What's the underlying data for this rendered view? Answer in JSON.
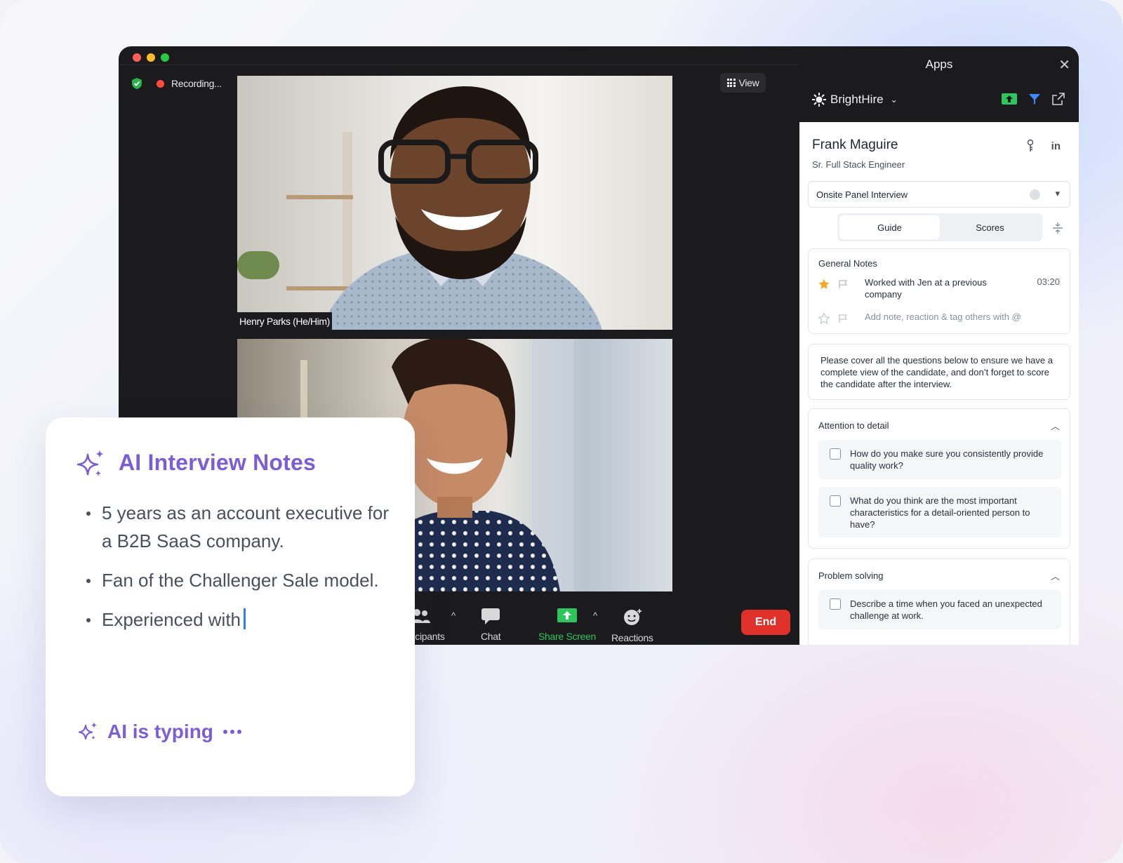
{
  "window": {
    "recording_label": "Recording...",
    "view_label": "View",
    "participant1_name": "Henry Parks (He/Him)",
    "toolbar": {
      "participants_label": "Participants",
      "chat_label": "Chat",
      "share_label": "Share Screen",
      "reactions_label": "Reactions",
      "end_label": "End"
    }
  },
  "apps": {
    "title": "Apps",
    "app_name": "BrightHire",
    "candidate": {
      "name": "Frank Maguire",
      "role": "Sr. Full Stack Engineer",
      "linkedin_label": "in"
    },
    "interview_select": "Onsite Panel Interview",
    "tabs": [
      "Guide",
      "Scores"
    ],
    "general_notes": {
      "title": "General Notes",
      "note_text": "Worked with Jen at a previous company",
      "note_time": "03:20",
      "add_placeholder": "Add note, reaction & tag others with @"
    },
    "guide_text": "Please cover all the questions below to ensure we have a complete view of the candidate, and don’t forget to score the candidate after the interview.",
    "sections": [
      {
        "title": "Attention to detail",
        "questions": [
          "How do you make sure you consistently provide quality work?",
          "What do you think are the most important characteristics for a detail-oriented person to have?"
        ]
      },
      {
        "title": "Problem solving",
        "questions": [
          "Describe a time when you faced an unexpected challenge at work."
        ]
      }
    ]
  },
  "ai_notes": {
    "title": "AI Interview Notes",
    "bullets": [
      "5 years as an account executive for a B2B SaaS company.",
      "Fan of the Challenger Sale model.",
      "Experienced with"
    ],
    "typing_label": "AI is typing"
  },
  "colors": {
    "accent_purple": "#7b5ed6",
    "share_green": "#2ec55d",
    "end_red": "#e0322a",
    "recording_red": "#ff4d3d"
  },
  "icons": [
    "shield-check-icon",
    "grid-icon",
    "participants-icon",
    "chat-icon",
    "share-screen-icon",
    "reactions-icon",
    "close-icon",
    "brighthire-logo-icon",
    "chevron-down-icon",
    "share-green-icon",
    "filter-icon",
    "external-link-icon",
    "key-icon",
    "linkedin-icon",
    "star-icon",
    "flag-icon",
    "split-icon",
    "sparkle-icon"
  ]
}
